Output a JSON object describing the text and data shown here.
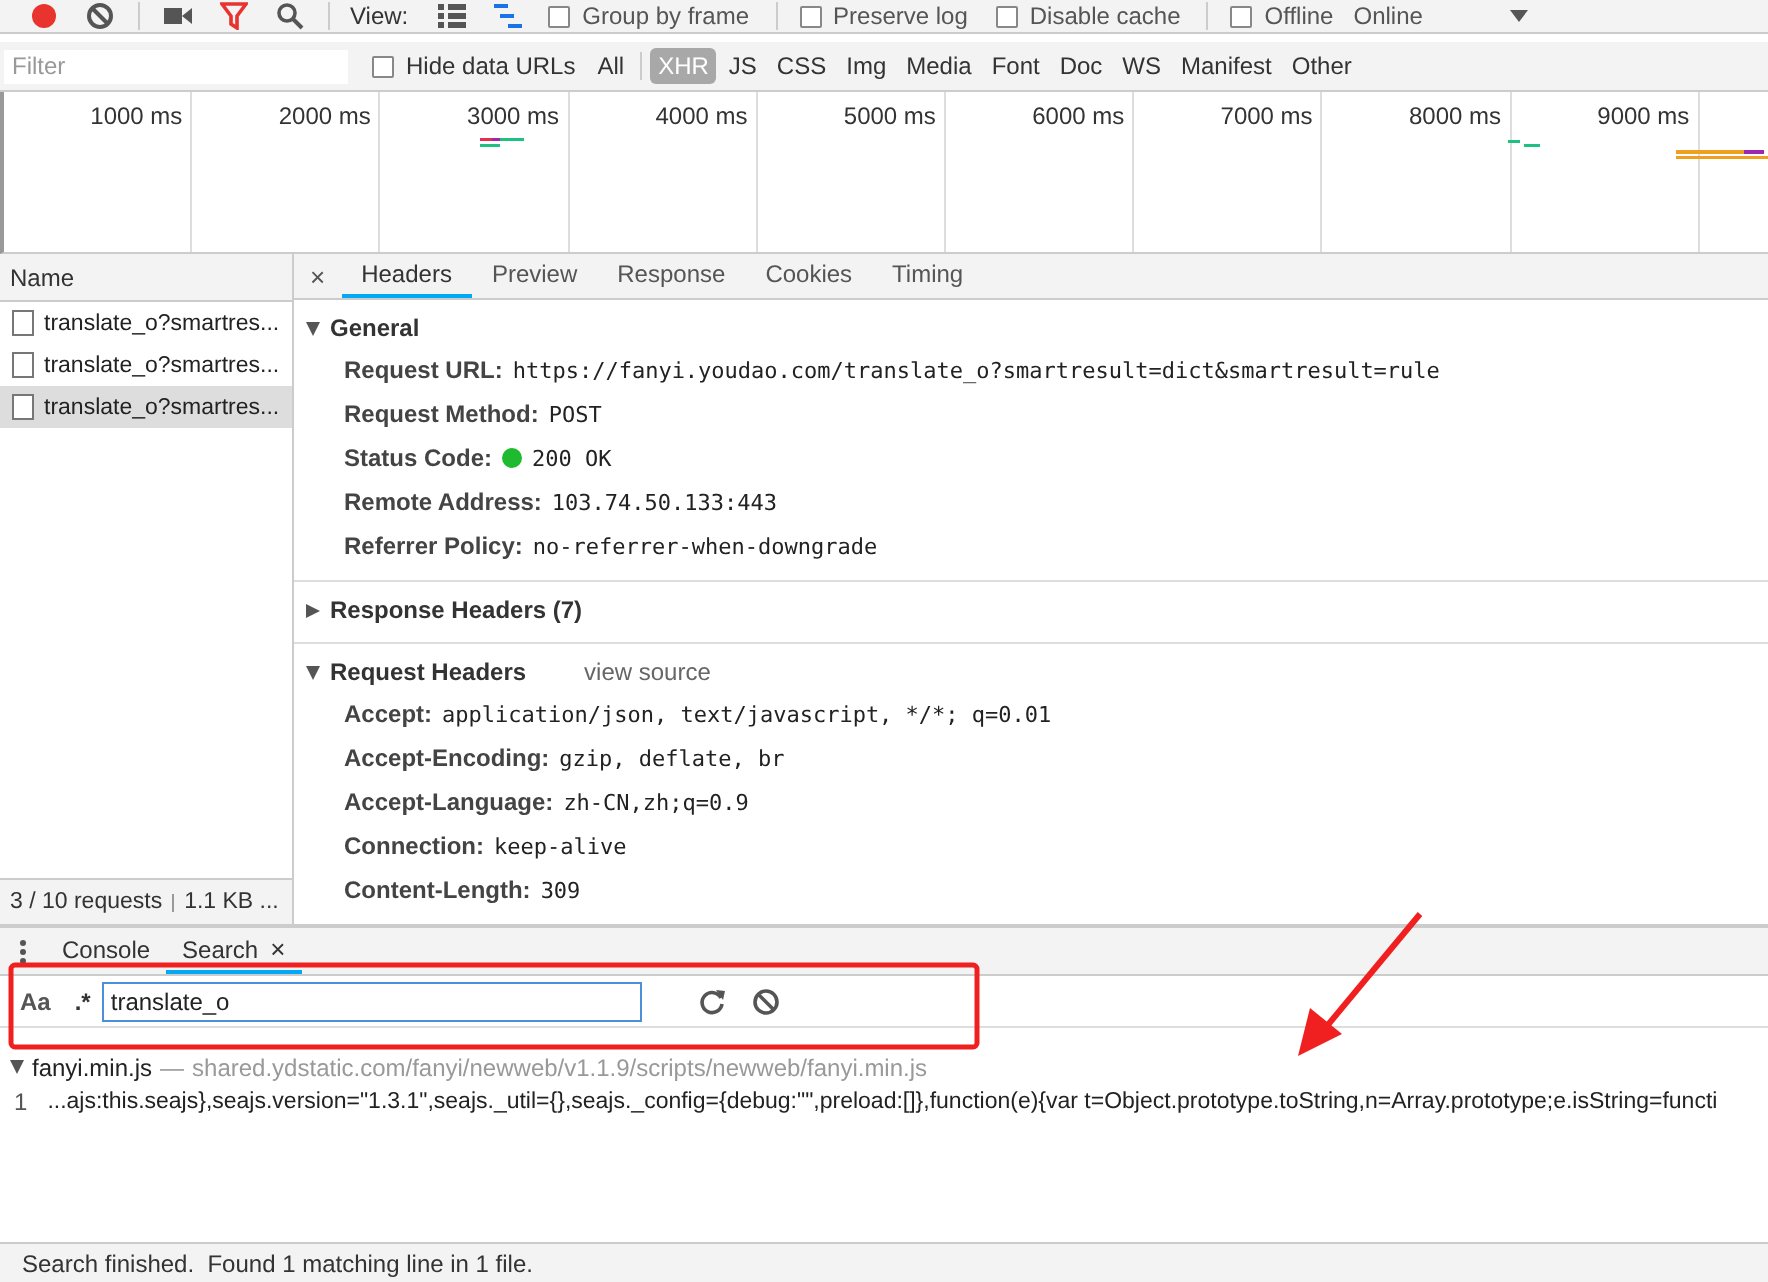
{
  "toolbar": {
    "recording": true,
    "filter_active": true,
    "view_label": "View:",
    "large_rows": false,
    "overview": true,
    "checkboxes": [
      {
        "label": "Group by frame",
        "checked": false
      },
      {
        "label": "Preserve log",
        "checked": false
      },
      {
        "label": "Disable cache",
        "checked": false
      },
      {
        "label": "Offline",
        "checked": false
      }
    ],
    "throttling": "Online"
  },
  "filter_bar": {
    "placeholder": "Filter",
    "hide_data_urls": {
      "label": "Hide data URLs",
      "checked": false
    },
    "types": [
      {
        "label": "All",
        "selected": false
      },
      {
        "label": "XHR",
        "selected": true
      },
      {
        "label": "JS",
        "selected": false
      },
      {
        "label": "CSS",
        "selected": false
      },
      {
        "label": "Img",
        "selected": false
      },
      {
        "label": "Media",
        "selected": false
      },
      {
        "label": "Font",
        "selected": false
      },
      {
        "label": "Doc",
        "selected": false
      },
      {
        "label": "WS",
        "selected": false
      },
      {
        "label": "Manifest",
        "selected": false
      },
      {
        "label": "Other",
        "selected": false
      }
    ]
  },
  "timeline": {
    "ticks": [
      "1000 ms",
      "2000 ms",
      "3000 ms",
      "4000 ms",
      "5000 ms",
      "6000 ms",
      "7000 ms",
      "8000 ms",
      "9000 ms"
    ]
  },
  "requests": {
    "column": "Name",
    "items": [
      {
        "name": "translate_o?smartres...",
        "selected": false
      },
      {
        "name": "translate_o?smartres...",
        "selected": false
      },
      {
        "name": "translate_o?smartres...",
        "selected": true
      }
    ],
    "summary": "3 / 10 requests",
    "transferred": "1.1 KB ..."
  },
  "details": {
    "close": "×",
    "tabs": [
      {
        "label": "Headers",
        "selected": true
      },
      {
        "label": "Preview",
        "selected": false
      },
      {
        "label": "Response",
        "selected": false
      },
      {
        "label": "Cookies",
        "selected": false
      },
      {
        "label": "Timing",
        "selected": false
      }
    ],
    "sections": [
      {
        "title": "General",
        "expanded": true,
        "rows": [
          {
            "name": "Request URL:",
            "value": "https://fanyi.youdao.com/translate_o?smartresult=dict&smartresult=rule"
          },
          {
            "name": "Request Method:",
            "value": "POST"
          },
          {
            "name": "Status Code:",
            "value": "200 OK",
            "color": "#1fbb2e"
          },
          {
            "name": "Remote Address:",
            "value": "103.74.50.133:443"
          },
          {
            "name": "Referrer Policy:",
            "value": "no-referrer-when-downgrade"
          }
        ]
      },
      {
        "title": "Response Headers (7)",
        "expanded": false
      },
      {
        "title": "Request Headers",
        "link": "view source",
        "expanded": true,
        "rows": [
          {
            "name": "Accept:",
            "value": "application/json, text/javascript, */*; q=0.01"
          },
          {
            "name": "Accept-Encoding:",
            "value": "gzip, deflate, br"
          },
          {
            "name": "Accept-Language:",
            "value": "zh-CN,zh;q=0.9"
          },
          {
            "name": "Connection:",
            "value": "keep-alive"
          },
          {
            "name": "Content-Length:",
            "value": "309"
          }
        ]
      }
    ]
  },
  "drawer": {
    "tabs": [
      {
        "label": "Console",
        "selected": false,
        "closable": false
      },
      {
        "label": "Search",
        "selected": true,
        "closable": true,
        "close": "×"
      }
    ],
    "search": {
      "match_case": "Aa",
      "regex": ".*",
      "value": "translate_o"
    },
    "results": [
      {
        "file": "fanyi.min.js",
        "separator": "—",
        "path": "shared.ydstatic.com/fanyi/newweb/v1.1.9/scripts/newweb/fanyi.min.js",
        "expanded": true,
        "matches": [
          {
            "line": "1",
            "text": "...ajs:this.seajs},seajs.version=\"1.3.1\",seajs._util={},seajs._config={debug:\"\",preload:[]},function(e){var t=Object.prototype.toString,n=Array.prototype;e.isString=functi"
          }
        ]
      }
    ],
    "status": "Search finished.  Found 1 matching line in 1 file."
  }
}
